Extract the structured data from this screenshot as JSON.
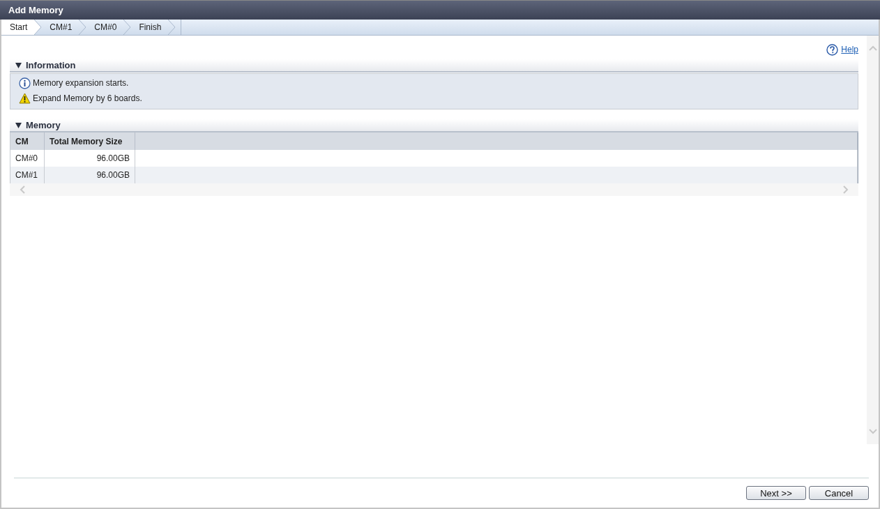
{
  "window": {
    "title": "Add Memory"
  },
  "steps": [
    {
      "label": "Start",
      "selected": true
    },
    {
      "label": "CM#1",
      "selected": false
    },
    {
      "label": "CM#0",
      "selected": false
    },
    {
      "label": "Finish",
      "selected": false
    }
  ],
  "help": {
    "label": "Help"
  },
  "information": {
    "title": "Information",
    "expanded": true,
    "messages": [
      {
        "kind": "info",
        "text": "Memory expansion starts."
      },
      {
        "kind": "warning",
        "text": "Expand Memory by 6 boards."
      }
    ]
  },
  "memory": {
    "title": "Memory",
    "expanded": true,
    "table": {
      "columns": [
        "CM",
        "Total Memory Size"
      ],
      "rows": [
        [
          "CM#0",
          "96.00GB"
        ],
        [
          "CM#1",
          "96.00GB"
        ]
      ]
    }
  },
  "buttons": [
    {
      "label": "Next >>"
    },
    {
      "label": "Cancel"
    }
  ]
}
